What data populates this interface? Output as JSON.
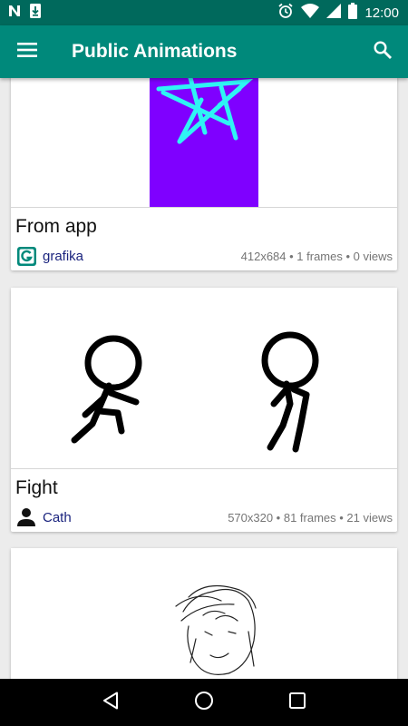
{
  "status_bar": {
    "time": "12:00",
    "icons": [
      "n-notification-icon",
      "download-notification-icon",
      "alarm-icon",
      "wifi-icon",
      "cell-signal-icon",
      "battery-icon"
    ]
  },
  "app_bar": {
    "title": "Public Animations",
    "menu_icon": "hamburger-menu-icon",
    "search_icon": "search-icon",
    "background": "#00897b",
    "status_background": "#00695c"
  },
  "feed": {
    "cards": [
      {
        "title": "From app",
        "author": "grafika",
        "author_icon": "grafika-logo-icon",
        "stats": "412x684 • 1 frames • 0 views",
        "preview": "purple background with cyan star drawing"
      },
      {
        "title": "Fight",
        "author": "Cath",
        "author_icon": "person-icon",
        "stats": "570x320 • 81 frames • 21 views",
        "preview": "two stick figures"
      },
      {
        "preview": "sketch of a face"
      }
    ]
  },
  "nav_bar": {
    "icons": [
      "back-icon",
      "home-icon",
      "recents-icon"
    ]
  },
  "colors": {
    "accent": "#00897b",
    "preview_purple": "#7f00ff",
    "preview_cyan": "#2ff4f4",
    "author_link": "#1a237e"
  }
}
